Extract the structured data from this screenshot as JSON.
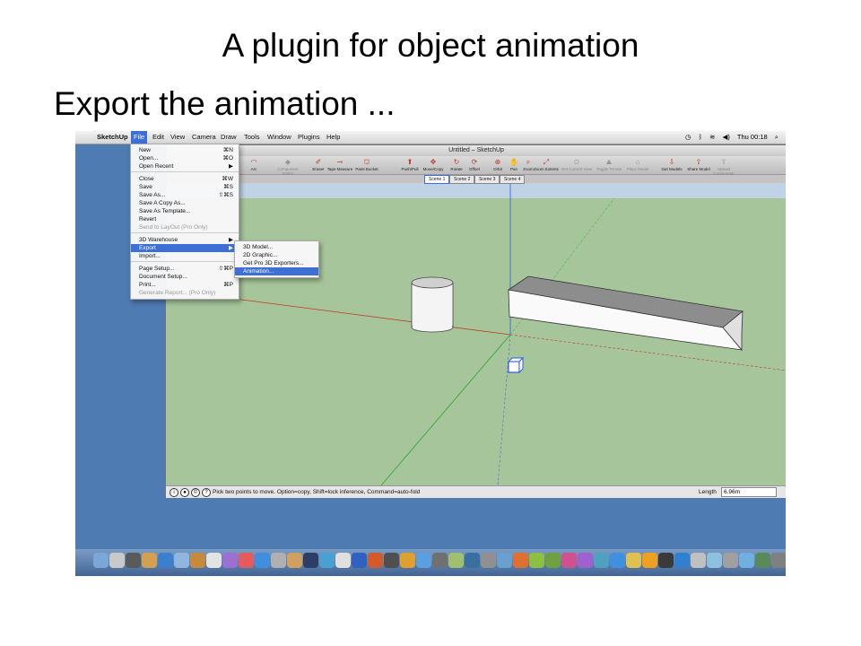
{
  "slide": {
    "title": "A plugin for object animation",
    "subtitle": "Export the animation ..."
  },
  "menubar": {
    "app": "SketchUp",
    "items": [
      "File",
      "Edit",
      "View",
      "Camera",
      "Draw",
      "Tools",
      "Window",
      "Plugins",
      "Help"
    ],
    "active": "File",
    "clock": "Thu 00:18"
  },
  "window": {
    "title": "Untitled – SketchUp"
  },
  "toolbar": {
    "tools": [
      {
        "label": "tle",
        "disabled": false
      },
      {
        "label": "Arc",
        "disabled": false
      },
      {
        "label": "Component Maker",
        "disabled": true
      },
      {
        "label": "Eraser",
        "disabled": false
      },
      {
        "label": "Tape Measure",
        "disabled": false
      },
      {
        "label": "Paint Bucket",
        "disabled": false
      },
      {
        "label": "Push/Pull",
        "disabled": false
      },
      {
        "label": "Move/Copy",
        "disabled": false
      },
      {
        "label": "Rotate",
        "disabled": false
      },
      {
        "label": "Offset",
        "disabled": false
      },
      {
        "label": "Orbit",
        "disabled": false
      },
      {
        "label": "Pan",
        "disabled": false
      },
      {
        "label": "Zoom",
        "disabled": false
      },
      {
        "label": "Zoom Extents",
        "disabled": false
      },
      {
        "label": "Get Current View",
        "disabled": true
      },
      {
        "label": "Toggle Terrain",
        "disabled": true
      },
      {
        "label": "Place Model",
        "disabled": true
      },
      {
        "label": "Get Models",
        "disabled": false
      },
      {
        "label": "Share Model",
        "disabled": false
      },
      {
        "label": "Upload Component",
        "disabled": true
      }
    ]
  },
  "scenes": [
    "Scene 1",
    "Scene 2",
    "Scene 3",
    "Scene 4"
  ],
  "file_menu": {
    "items": [
      {
        "label": "New",
        "shortcut": "⌘N"
      },
      {
        "label": "Open...",
        "shortcut": "⌘O"
      },
      {
        "label": "Open Recent",
        "shortcut": "▶"
      },
      {
        "label": "Close",
        "shortcut": "⌘W"
      },
      {
        "label": "Save",
        "shortcut": "⌘S"
      },
      {
        "label": "Save As...",
        "shortcut": "⇧⌘S"
      },
      {
        "label": "Save A Copy As...",
        "shortcut": ""
      },
      {
        "label": "Save As Template...",
        "shortcut": ""
      },
      {
        "label": "Revert",
        "shortcut": ""
      },
      {
        "label": "Send to LayOut (Pro Only)",
        "shortcut": "",
        "disabled": true
      },
      {
        "label": "3D Warehouse",
        "shortcut": "▶"
      },
      {
        "label": "Export",
        "shortcut": "▶",
        "active": true
      },
      {
        "label": "Import...",
        "shortcut": ""
      },
      {
        "label": "Page Setup...",
        "shortcut": "⇧⌘P"
      },
      {
        "label": "Document Setup...",
        "shortcut": ""
      },
      {
        "label": "Print...",
        "shortcut": "⌘P"
      },
      {
        "label": "Generate Report... (Pro Only)",
        "shortcut": "",
        "disabled": true
      }
    ]
  },
  "export_menu": {
    "items": [
      {
        "label": "3D Model..."
      },
      {
        "label": "2D Graphic..."
      },
      {
        "label": "Get Pro 3D Exporters..."
      },
      {
        "label": "Animation...",
        "active": true
      }
    ]
  },
  "statusbar": {
    "hint": "Pick two points to move.  Option=copy, Shift=lock inference, Command=auto-fold",
    "length_label": "Length",
    "length_value": "6.96m"
  },
  "colors": {
    "desktop": "#4f7bb3",
    "ground": "#a7c59a",
    "selection": "#3d6fd6"
  }
}
